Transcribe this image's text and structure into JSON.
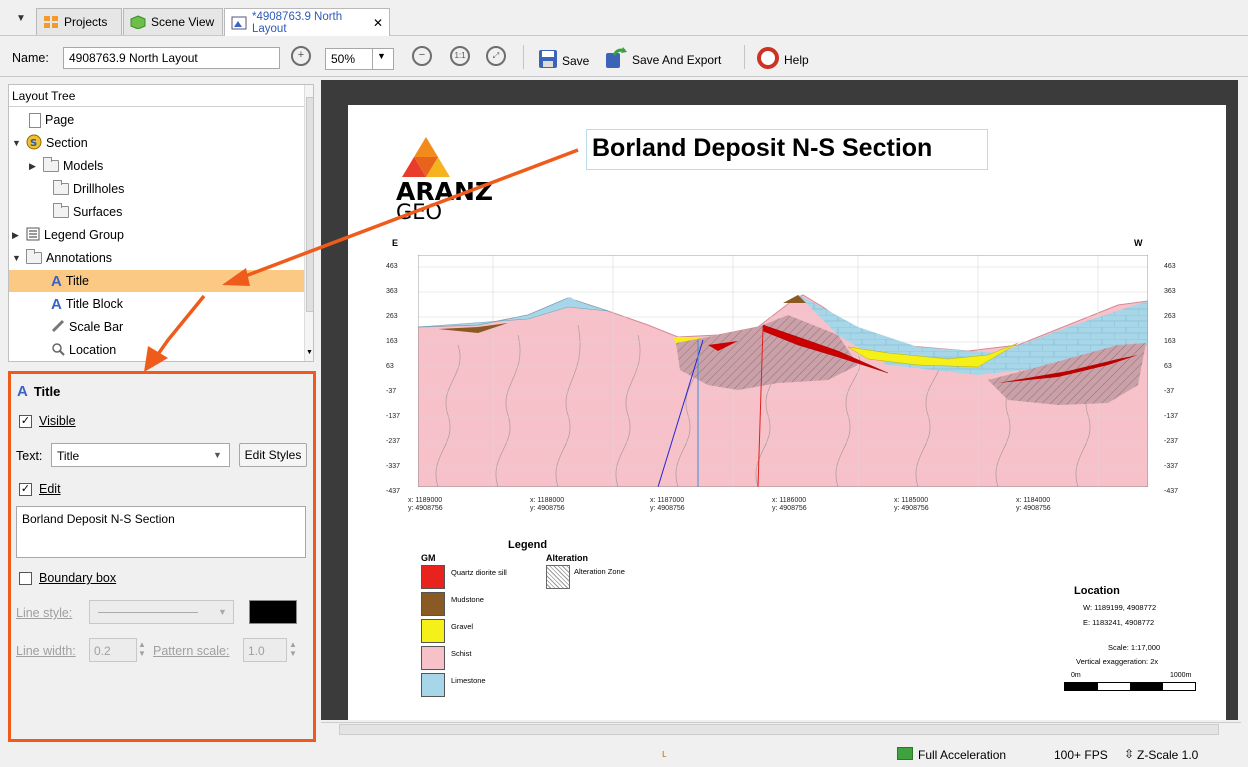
{
  "tabs": [
    {
      "label": "Projects",
      "icon": "projects-icon"
    },
    {
      "label": "Scene View",
      "icon": "scene-view-icon"
    },
    {
      "label": "*4908763.9 North Layout",
      "icon": "layout-icon",
      "close": "✕"
    }
  ],
  "toolbar": {
    "name_label": "Name:",
    "name_value": "4908763.9 North Layout",
    "zoom_value": "50%",
    "save_label": "Save",
    "save_export_label": "Save And Export",
    "help_label": "Help"
  },
  "tree": {
    "header": "Layout Tree",
    "items": [
      {
        "label": "Page"
      },
      {
        "label": "Section"
      },
      {
        "label": "Models"
      },
      {
        "label": "Drillholes"
      },
      {
        "label": "Surfaces"
      },
      {
        "label": "Legend Group"
      },
      {
        "label": "Annotations"
      },
      {
        "label": "Title"
      },
      {
        "label": "Title Block"
      },
      {
        "label": "Scale Bar"
      },
      {
        "label": "Location"
      }
    ]
  },
  "props": {
    "heading": "Title",
    "visible_label": "Visible",
    "text_label": "Text:",
    "text_value": "Title",
    "edit_styles": "Edit Styles",
    "edit_label": "Edit",
    "edit_text": "Borland Deposit N-S Section",
    "boundary_label": "Boundary box",
    "line_style_label": "Line style:",
    "line_width_label": "Line width:",
    "line_width_value": "0.2",
    "pattern_scale_label": "Pattern scale:",
    "pattern_scale_value": "1.0"
  },
  "layout_page": {
    "title": "Borland Deposit N-S Section",
    "logo_top": "ARANZ",
    "logo_bottom": "GEO",
    "east": "E",
    "west": "W",
    "elevations": [
      "463",
      "363",
      "263",
      "163",
      "63",
      "-37",
      "-137",
      "-237",
      "-337",
      "-437"
    ],
    "xcoords": [
      "x: 1189000",
      "x: 1188000",
      "x: 1187000",
      "x: 1186000",
      "x: 1185000",
      "x: 1184000"
    ],
    "ycoord": "y: 4908756",
    "legend_title": "Legend",
    "gm_header": "GM",
    "alteration_header": "Alteration",
    "gm_items": [
      {
        "label": "Quartz diorite sill",
        "color": "#e8221c"
      },
      {
        "label": "Mudstone",
        "color": "#8a5a24"
      },
      {
        "label": "Gravel",
        "color": "#f5f018"
      },
      {
        "label": "Schist",
        "color": "#f7c1ca"
      },
      {
        "label": "Limestone",
        "color": "#a6d6e8"
      }
    ],
    "alteration_item": "Alteration Zone",
    "location_title": "Location",
    "loc_w": "W:  1189199, 4908772",
    "loc_e": "E:  1183241, 4908772",
    "scale": "Scale: 1:17,000",
    "vert": "Vertical exaggeration: 2x",
    "scale_start": "0m",
    "scale_end": "1000m"
  },
  "status": {
    "accel": "Full Acceleration",
    "fps": "100+ FPS",
    "zscale": "Z-Scale 1.0"
  },
  "colors": {
    "accent_orange": "#ef5b1a",
    "selection": "#fbc983"
  }
}
